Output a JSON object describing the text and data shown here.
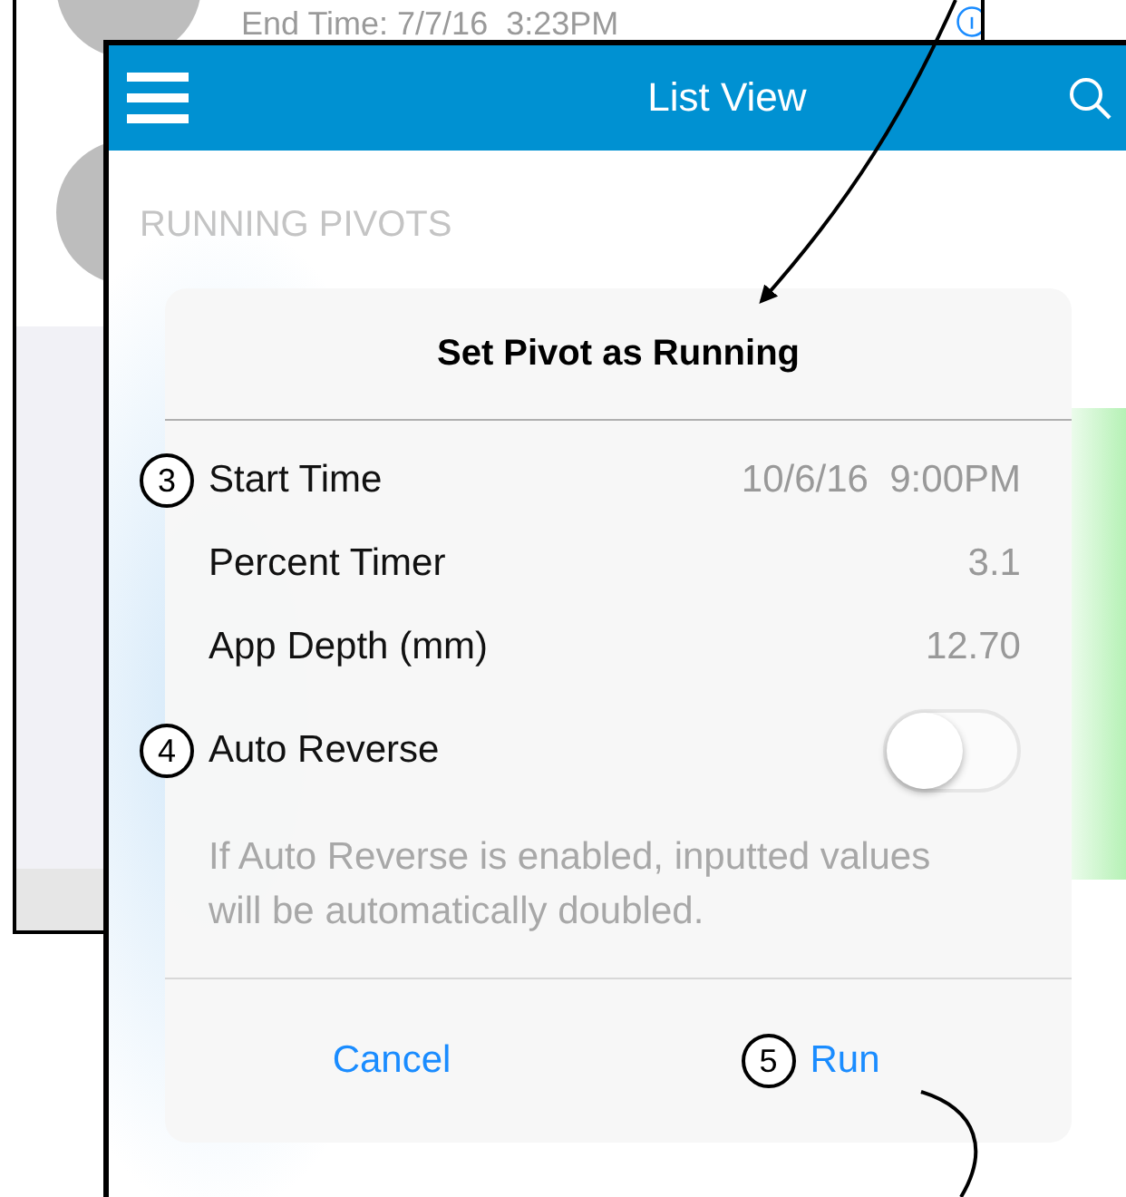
{
  "background_window": {
    "end_time": "End Time: 7/7/16  3:23PM"
  },
  "app": {
    "header": {
      "title": "List View"
    },
    "section_header": "RUNNING PIVOTS",
    "alert": {
      "title": "Set Pivot as Running",
      "rows": [
        {
          "kind": "value",
          "label": "Start Time",
          "value": "10/6/16  9:00PM",
          "callout": "3"
        },
        {
          "kind": "value",
          "label": "Percent Timer",
          "value": "3.1"
        },
        {
          "kind": "value",
          "label": "App Depth (mm)",
          "value": "12.70"
        },
        {
          "kind": "toggle",
          "label": "Auto Reverse",
          "on": false,
          "callout": "4"
        }
      ],
      "note": "If Auto Reverse is enabled, inputted values will be automatically doubled.",
      "buttons": [
        {
          "label": "Cancel"
        },
        {
          "label": "Run",
          "callout": "5"
        }
      ]
    }
  }
}
